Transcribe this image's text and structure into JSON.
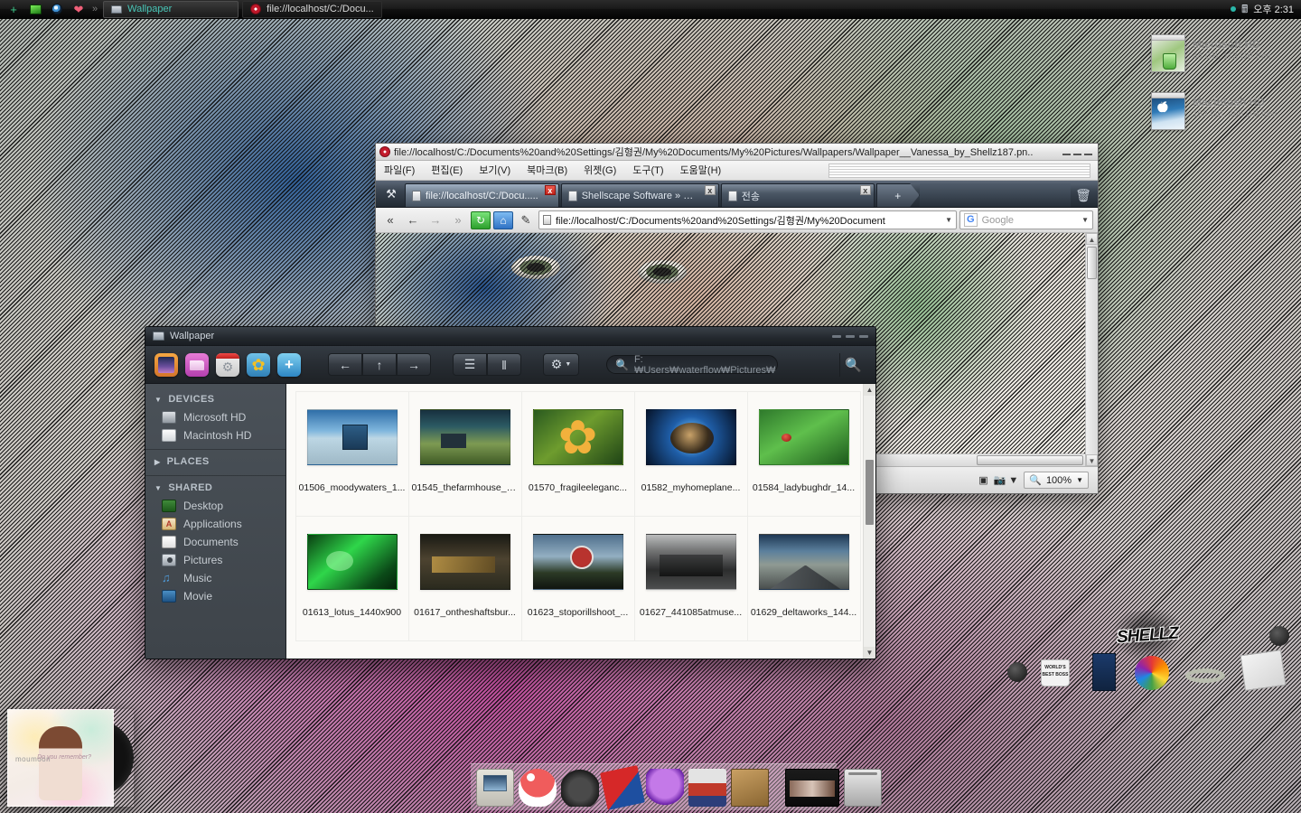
{
  "taskbar": {
    "icons": [
      "plus-icon",
      "screen-icon",
      "eye-icon",
      "heart-icon"
    ],
    "overflow_label": "»",
    "tasks": [
      {
        "label": "Wallpaper",
        "icon": "folder-icon",
        "active": true
      },
      {
        "label": "file://localhost/C:/Docu...",
        "icon": "opera-icon",
        "active": false
      }
    ],
    "tray": {
      "network_icon": "network-signal-icon",
      "clock": "오후 2:31"
    }
  },
  "desktop": {
    "icons": [
      {
        "name": "Microsoft HD",
        "sub": "44 GB, 113 GB free"
      },
      {
        "name": "Macintosh HD",
        "sub": "153 GB, 466 GB free"
      }
    ],
    "album_widget": {
      "artist": "moumoon",
      "title": "Do you remember?"
    },
    "deco": {
      "logo": "SHELLZ",
      "mug_text": "WORLD'S BEST BOSS"
    }
  },
  "browser": {
    "title": "file://localhost/C:/Documents%20and%20Settings/김형권/My%20Documents/My%20Pictures/Wallpapers/Wallpaper__Vanessa_by_Shellz187.pn..",
    "menus": [
      "파일(F)",
      "편집(E)",
      "보기(V)",
      "북마크(B)",
      "위젯(G)",
      "도구(T)",
      "도움말(H)"
    ],
    "tabs": [
      {
        "label": "file://localhost/C:/Docu.....",
        "active": true,
        "close_highlight": true
      },
      {
        "label": "Shellscape Software » R...",
        "active": false,
        "close_highlight": false
      },
      {
        "label": "전송",
        "active": false,
        "close_highlight": false
      }
    ],
    "new_tab_label": "+",
    "address": "file://localhost/C:/Documents%20and%20Settings/김형권/My%20Document",
    "search_placeholder": "Google",
    "search_engine_badge": "G",
    "status": {
      "zoom": "100%"
    },
    "nav": {
      "fast_back": "«",
      "back": "←",
      "forward": "→",
      "fast_forward": "»",
      "reload": "↻",
      "home": "⌂",
      "edit": "✎"
    }
  },
  "filemanager": {
    "title": "Wallpaper",
    "app_icons": [
      "image-viewer-icon",
      "folder-pink-icon",
      "settings-gear-icon",
      "photo-sunflower-icon",
      "add-image-icon"
    ],
    "nav": {
      "back": "←",
      "up": "↑",
      "forward": "→"
    },
    "view": {
      "list": "☰",
      "columns": "‖"
    },
    "gear_label": "⚙",
    "path_value": "F:₩Users₩waterflow₩Pictures₩",
    "search_icon": "search-icon",
    "sidebar": [
      {
        "type": "header",
        "label": "DEVICES",
        "expanded": true
      },
      {
        "type": "item",
        "label": "Microsoft HD",
        "icon": "hard-drive-icon"
      },
      {
        "type": "item",
        "label": "Macintosh HD",
        "icon": "hard-drive-icon"
      },
      {
        "type": "header",
        "label": "PLACES",
        "expanded": false
      },
      {
        "type": "header",
        "label": "SHARED",
        "expanded": true
      },
      {
        "type": "item",
        "label": "Desktop",
        "icon": "desktop-icon"
      },
      {
        "type": "item",
        "label": "Applications",
        "icon": "applications-icon"
      },
      {
        "type": "item",
        "label": "Documents",
        "icon": "document-icon"
      },
      {
        "type": "item",
        "label": "Pictures",
        "icon": "camera-icon"
      },
      {
        "type": "item",
        "label": "Music",
        "icon": "music-note-icon"
      },
      {
        "type": "item",
        "label": "Movie",
        "icon": "film-icon"
      }
    ],
    "files": [
      {
        "name": "01506_moodywaters_1...",
        "thumb": "t-moody"
      },
      {
        "name": "01545_thefarmhouse_1...",
        "thumb": "t-farm"
      },
      {
        "name": "01570_fragileeleganc...",
        "thumb": "t-flower"
      },
      {
        "name": "01582_myhomeplane...",
        "thumb": "t-planet"
      },
      {
        "name": "01584_ladybughdr_14...",
        "thumb": "t-lady"
      },
      {
        "name": "01613_lotus_1440x900",
        "thumb": "t-lotus"
      },
      {
        "name": "01617_ontheshaftsbur...",
        "thumb": "t-shafts"
      },
      {
        "name": "01623_stoporillshoot_...",
        "thumb": "t-stop"
      },
      {
        "name": "01627_441085atmuse...",
        "thumb": "t-train"
      },
      {
        "name": "01629_deltaworks_144...",
        "thumb": "t-delta"
      }
    ]
  },
  "dock": {
    "items": [
      "classic-mac-icon",
      "mushroom-icon",
      "headphones-icon",
      "books-icon",
      "lightbulb-icon",
      "truck-icon",
      "crate-icon"
    ],
    "right_items": [
      "film-strip-icon",
      "trash-icon"
    ]
  },
  "colors": {
    "accent_teal": "#49c7b8",
    "window_dark": "#2c3137",
    "sidebar": "#4a5158",
    "content_bg": "#fbfaf7",
    "opera_red": "#c41b2c"
  }
}
